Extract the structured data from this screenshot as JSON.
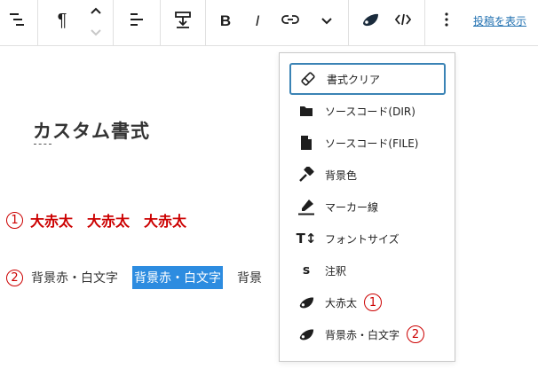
{
  "toolbar": {
    "paragraph_symbol": "¶",
    "bold_label": "B",
    "italic_label": "I",
    "view_post_label": "投稿を表示"
  },
  "content": {
    "heading": "カスタム書式",
    "line1": {
      "number": "1",
      "items": [
        "大赤太",
        "大赤太",
        "大赤太"
      ]
    },
    "line2": {
      "number": "2",
      "plain_text": "背景赤・白文字",
      "highlighted_text": "背景赤・白文字",
      "trailing_text": "背景"
    }
  },
  "format_menu": {
    "items": [
      {
        "label": "書式クリア",
        "icon": "eraser-icon",
        "active": true
      },
      {
        "label": "ソースコード(DIR)",
        "icon": "folder-icon"
      },
      {
        "label": "ソースコード(FILE)",
        "icon": "file-icon"
      },
      {
        "label": "背景色",
        "icon": "paint-brush-icon"
      },
      {
        "label": "マーカー線",
        "icon": "marker-pen-icon"
      },
      {
        "label": "フォントサイズ",
        "icon": "font-size-icon",
        "icon_text": "T↕"
      },
      {
        "label": "注釈",
        "icon": "annotation-icon",
        "icon_text": "s"
      },
      {
        "label": "大赤太",
        "icon": "custom-format-icon",
        "badge": "1"
      },
      {
        "label": "背景赤・白文字",
        "icon": "custom-format-icon",
        "badge": "2"
      }
    ]
  },
  "colors": {
    "accent_red": "#cc0000",
    "highlight_blue": "#2d8ce0",
    "link_blue": "#2271b1",
    "active_border": "#3a83b5"
  }
}
